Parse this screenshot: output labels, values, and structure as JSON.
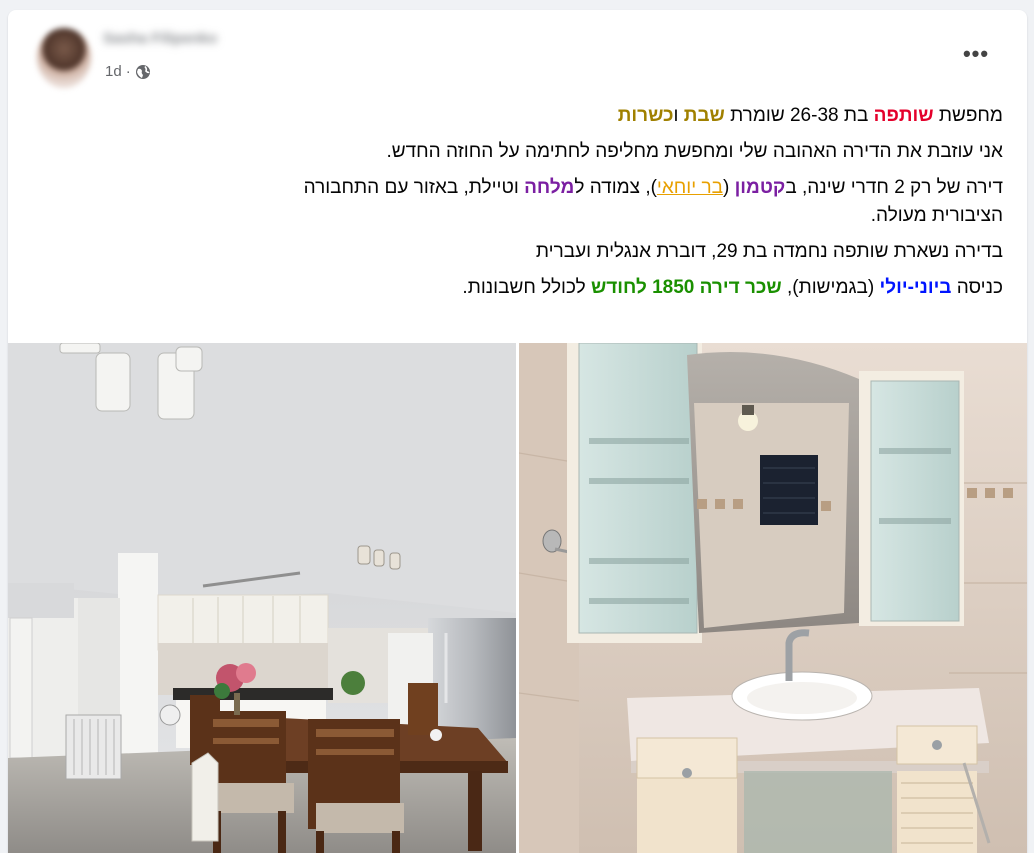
{
  "post": {
    "author": "Sasha Filipenko",
    "time": "1d",
    "separator": "·",
    "privacy_icon": "globe-icon",
    "more_icon": "more-options-icon",
    "more_label": "•••"
  },
  "text": {
    "line1": {
      "a": "מחפשת ",
      "b": "שותפה",
      "c": " בת 26-38 שומרת ",
      "d": "שבת",
      "e": " ו",
      "f": "כשרות"
    },
    "line2": "אני עוזבת את הדירה האהובה שלי ומחפשת מחליפה לחתימה על החוזה החדש.",
    "line3": {
      "a": "דירה של רק 2 חדרי שינה, ב",
      "b": "קטמון",
      "c": " (",
      "d": "בר יוחאי",
      "e": "), צמודה ל",
      "f": "מלחה",
      "g": " וטיילת, באזור עם התחבורה הציבורית מעולה."
    },
    "line4": "בדירה נשארת שותפה נחמדה בת 29, דוברת אנגלית ועברית",
    "line5": {
      "a": "כניסה ",
      "b": "ביוני-יולי",
      "c": " (בגמישות), ",
      "d": "שכר דירה 1850 לחודש",
      "e": " לכולל חשבונות."
    }
  },
  "colors": {
    "red": "#e4002b",
    "olive": "#a08000",
    "purple": "#7b1fa2",
    "orange": "#e8a000",
    "blue": "#0015ff",
    "green": "#1a9000"
  },
  "photos": [
    {
      "subject": "kitchen and dining area"
    },
    {
      "subject": "bathroom sink with mirror cabinet"
    }
  ]
}
